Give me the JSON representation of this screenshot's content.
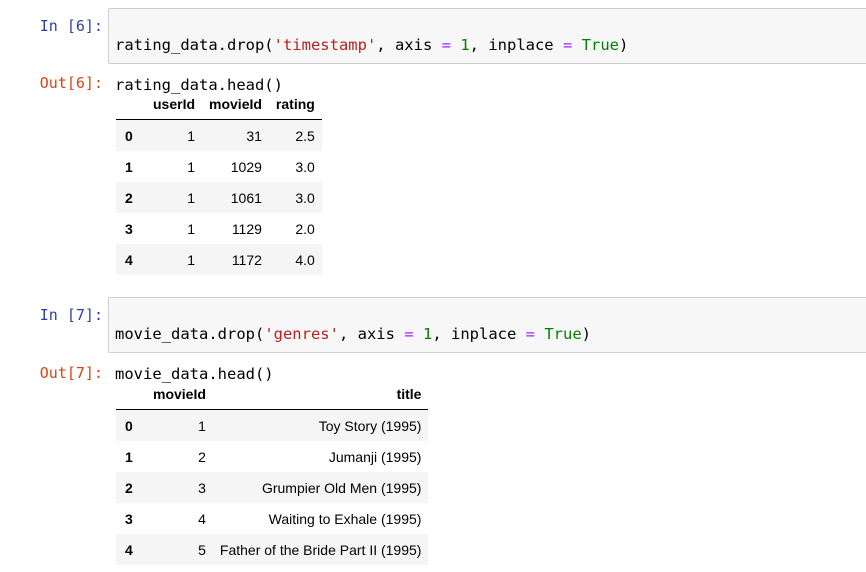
{
  "cells": [
    {
      "in_prompt": "In [6]:",
      "out_prompt": "Out[6]:",
      "code": {
        "line1": {
          "pre": "rating_data.drop(",
          "str": "'timestamp'",
          "mid1": ", axis ",
          "eq1": "=",
          "sp1": " ",
          "num": "1",
          "mid2": ", inplace ",
          "eq2": "=",
          "sp2": " ",
          "kw": "True",
          "close": ")"
        },
        "line2": "rating_data.head()"
      },
      "table": {
        "columns": [
          "",
          "userId",
          "movieId",
          "rating"
        ],
        "rows": [
          [
            "0",
            "1",
            "31",
            "2.5"
          ],
          [
            "1",
            "1",
            "1029",
            "3.0"
          ],
          [
            "2",
            "1",
            "1061",
            "3.0"
          ],
          [
            "3",
            "1",
            "1129",
            "2.0"
          ],
          [
            "4",
            "1",
            "1172",
            "4.0"
          ]
        ]
      }
    },
    {
      "in_prompt": "In [7]:",
      "out_prompt": "Out[7]:",
      "code": {
        "line1": {
          "pre": "movie_data.drop(",
          "str": "'genres'",
          "mid1": ", axis ",
          "eq1": "=",
          "sp1": " ",
          "num": "1",
          "mid2": ", inplace ",
          "eq2": "=",
          "sp2": " ",
          "kw": "True",
          "close": ")"
        },
        "line2": "movie_data.head()"
      },
      "table": {
        "columns": [
          "",
          "movieId",
          "title"
        ],
        "rows": [
          [
            "0",
            "1",
            "Toy Story (1995)"
          ],
          [
            "1",
            "2",
            "Jumanji (1995)"
          ],
          [
            "2",
            "3",
            "Grumpier Old Men (1995)"
          ],
          [
            "3",
            "4",
            "Waiting to Exhale (1995)"
          ],
          [
            "4",
            "5",
            "Father of the Bride Part II (1995)"
          ]
        ]
      }
    }
  ]
}
